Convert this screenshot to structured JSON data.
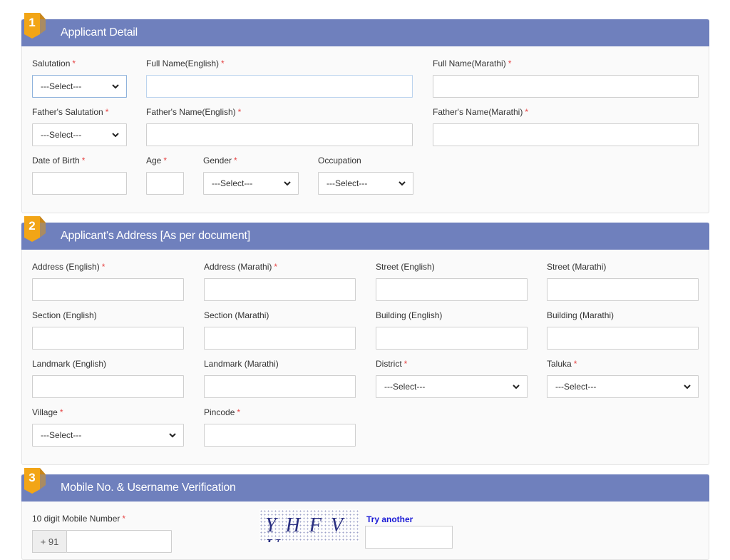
{
  "colors": {
    "header_bg": "#6f80bd",
    "badge": "#f2a516",
    "badge_fold": "#c9861a",
    "required": "#e64545",
    "link": "#1b1bd6"
  },
  "required_mark": "*",
  "sections": [
    {
      "number": "1",
      "title": "Applicant Detail",
      "fields": {
        "salutation": {
          "label": "Salutation",
          "value": "---Select---"
        },
        "full_name_en": {
          "label": "Full Name(English)",
          "value": ""
        },
        "full_name_mr": {
          "label": "Full Name(Marathi)",
          "value": ""
        },
        "father_salutation": {
          "label": "Father's Salutation",
          "value": "---Select---"
        },
        "father_name_en": {
          "label": "Father's Name(English)",
          "value": ""
        },
        "father_name_mr": {
          "label": "Father's Name(Marathi)",
          "value": ""
        },
        "dob": {
          "label": "Date of Birth",
          "value": ""
        },
        "age": {
          "label": "Age",
          "value": ""
        },
        "gender": {
          "label": "Gender",
          "value": "---Select---"
        },
        "occupation": {
          "label": "Occupation",
          "value": "---Select---"
        }
      }
    },
    {
      "number": "2",
      "title": "Applicant's Address [As per document]",
      "fields": {
        "address_en": {
          "label": "Address (English)",
          "value": ""
        },
        "address_mr": {
          "label": "Address (Marathi)",
          "value": ""
        },
        "street_en": {
          "label": "Street (English)",
          "value": ""
        },
        "street_mr": {
          "label": "Street (Marathi)",
          "value": ""
        },
        "section_en": {
          "label": "Section (English)",
          "value": ""
        },
        "section_mr": {
          "label": "Section (Marathi)",
          "value": ""
        },
        "building_en": {
          "label": "Building (English)",
          "value": ""
        },
        "building_mr": {
          "label": "Building (Marathi)",
          "value": ""
        },
        "landmark_en": {
          "label": "Landmark (English)",
          "value": ""
        },
        "landmark_mr": {
          "label": "Landmark (Marathi)",
          "value": ""
        },
        "district": {
          "label": "District",
          "value": "---Select---"
        },
        "taluka": {
          "label": "Taluka",
          "value": "---Select---"
        },
        "village": {
          "label": "Village",
          "value": "---Select---"
        },
        "pincode": {
          "label": "Pincode",
          "value": ""
        }
      }
    },
    {
      "number": "3",
      "title": "Mobile No. & Username Verification",
      "fields": {
        "mobile": {
          "label": "10 digit Mobile Number",
          "prefix": "+ 91",
          "value": ""
        },
        "captcha": {
          "text": "YHFVU",
          "try_another": "Try another",
          "value": ""
        }
      }
    }
  ]
}
